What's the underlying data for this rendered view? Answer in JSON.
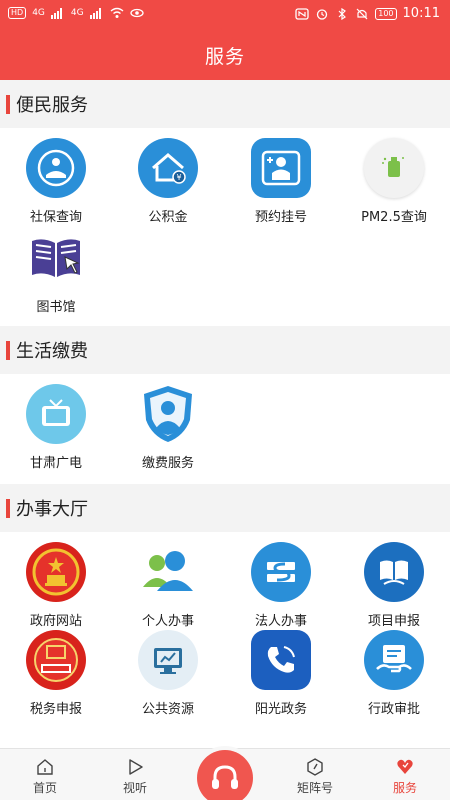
{
  "status_bar": {
    "left_badges": [
      "HD",
      "4G",
      "4G"
    ],
    "battery": "100",
    "time": "10:11"
  },
  "header": {
    "title": "服务"
  },
  "sections": [
    {
      "title": "便民服务",
      "items": [
        {
          "label": "社保查询",
          "icon": "social-security-icon"
        },
        {
          "label": "公积金",
          "icon": "housing-fund-icon"
        },
        {
          "label": "预约挂号",
          "icon": "doctor-appointment-icon"
        },
        {
          "label": "PM2.5查询",
          "icon": "air-quality-icon"
        },
        {
          "label": "图书馆",
          "icon": "library-book-icon"
        }
      ]
    },
    {
      "title": "生活缴费",
      "items": [
        {
          "label": "甘肃广电",
          "icon": "tv-icon"
        },
        {
          "label": "缴费服务",
          "icon": "payment-shield-icon"
        }
      ]
    },
    {
      "title": "办事大厅",
      "items": [
        {
          "label": "政府网站",
          "icon": "national-emblem-icon"
        },
        {
          "label": "个人办事",
          "icon": "people-icon"
        },
        {
          "label": "法人办事",
          "icon": "legal-entity-icon"
        },
        {
          "label": "项目申报",
          "icon": "project-book-icon"
        },
        {
          "label": "税务申报",
          "icon": "tax-icon"
        },
        {
          "label": "公共资源",
          "icon": "public-resource-icon"
        },
        {
          "label": "阳光政务",
          "icon": "phone-icon"
        },
        {
          "label": "行政审批",
          "icon": "approval-icon"
        }
      ]
    }
  ],
  "bottom_nav": {
    "items": [
      {
        "label": "首页",
        "icon": "home-icon"
      },
      {
        "label": "视听",
        "icon": "play-icon"
      },
      {
        "label": "矩阵号",
        "icon": "compass-icon"
      },
      {
        "label": "服务",
        "icon": "service-heart-icon",
        "active": true
      }
    ],
    "center_icon": "headset-icon"
  },
  "colors": {
    "accent": "#f04a45",
    "icon_blue": "#2a8fd8",
    "section_bg": "#f3f3f3"
  }
}
